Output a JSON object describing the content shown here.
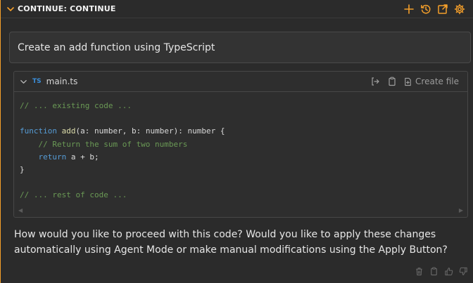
{
  "header": {
    "title": "CONTINUE: CONTINUE",
    "accent": "#f59f2a",
    "icons": [
      "plus-icon",
      "history-icon",
      "open-external-icon",
      "gear-icon"
    ]
  },
  "prompt": {
    "text": "Create an add function using TypeScript"
  },
  "code_block": {
    "lang_badge": "TS",
    "filename": "main.ts",
    "create_file_label": "Create file",
    "lines": [
      "// ... existing code ...",
      "",
      "function add(a: number, b: number): number {",
      "    // Return the sum of two numbers",
      "    return a + b;",
      "}",
      "",
      "// ... rest of code ..."
    ]
  },
  "assistant_message": {
    "text": "How would you like to proceed with this code? Would you like to apply these changes automatically using Agent Mode or make manual modifications using the Apply Button?"
  },
  "colors": {
    "background": "#2b2b2b",
    "panel_border": "#474747",
    "comment": "#6a9955",
    "keyword": "#569cd6",
    "function": "#dcdcaa",
    "ts_badge": "#3b8ed9"
  }
}
